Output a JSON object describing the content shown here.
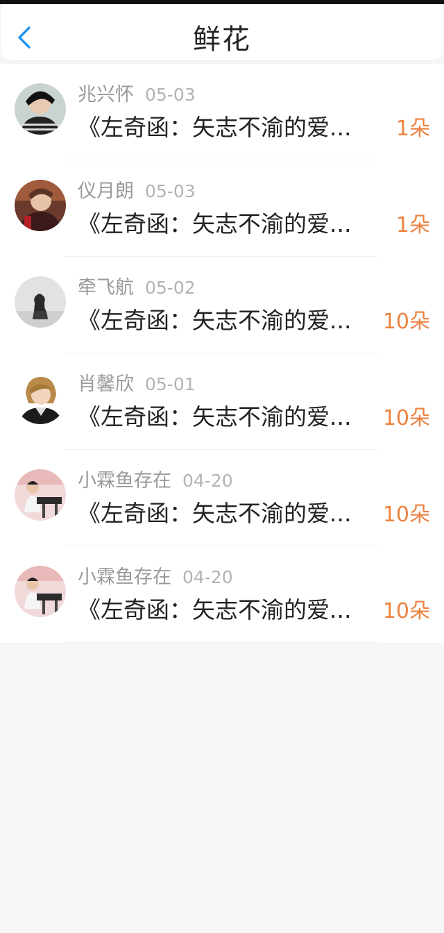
{
  "header": {
    "title": "鲜花"
  },
  "items": [
    {
      "name": "兆兴怀",
      "date": "05-03",
      "message": "《左奇函：矢志不渝的爱...",
      "count": "1朵"
    },
    {
      "name": "仪月朗",
      "date": "05-03",
      "message": "《左奇函：矢志不渝的爱...",
      "count": "1朵"
    },
    {
      "name": "牵飞航",
      "date": "05-02",
      "message": "《左奇函：矢志不渝的爱...",
      "count": "10朵"
    },
    {
      "name": "肖馨欣",
      "date": "05-01",
      "message": "《左奇函：矢志不渝的爱...",
      "count": "10朵"
    },
    {
      "name": "小霖鱼存在",
      "date": "04-20",
      "message": "《左奇函：矢志不渝的爱...",
      "count": "10朵"
    },
    {
      "name": "小霖鱼存在",
      "date": "04-20",
      "message": "《左奇函：矢志不渝的爱...",
      "count": "10朵"
    }
  ],
  "colors": {
    "accent": "#2196F3",
    "count": "#ec8240"
  },
  "icons": {
    "back": "chevron-left-icon"
  }
}
